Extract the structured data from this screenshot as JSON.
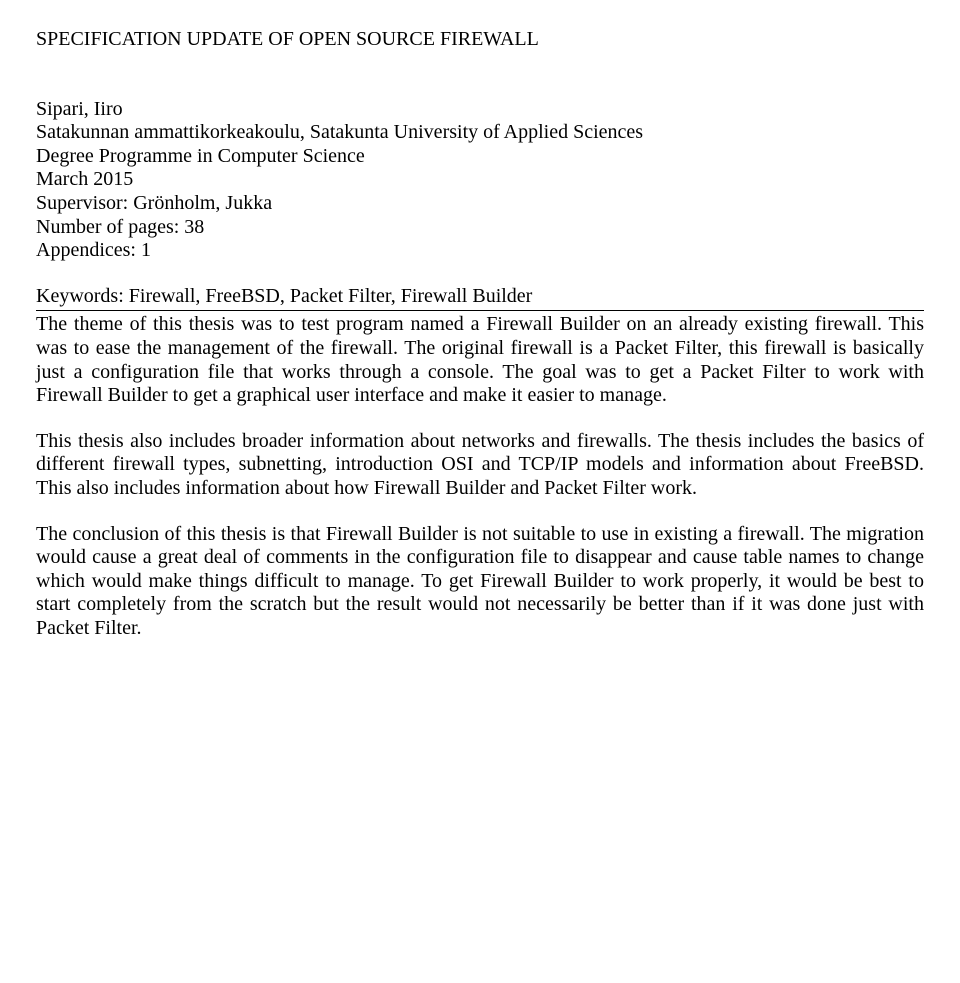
{
  "title": "SPECIFICATION UPDATE OF OPEN SOURCE FIREWALL",
  "meta": {
    "author": "Sipari, Iiro",
    "institution": "Satakunnan ammattikorkeakoulu, Satakunta University of Applied Sciences",
    "programme": "Degree Programme in Computer Science",
    "date": "March 2015",
    "supervisor": "Supervisor: Grönholm, Jukka",
    "pages": "Number of pages: 38",
    "appendices": "Appendices: 1"
  },
  "keywords": "Keywords: Firewall, FreeBSD, Packet Filter, Firewall Builder",
  "paragraphs": {
    "p1": "The theme of this thesis was to test program named a Firewall Builder on an already existing firewall. This was to ease the management of the firewall. The original firewall is a Packet Filter, this firewall is basically just a configuration file that works through a console. The goal was to get a Packet Filter to work with Firewall Builder to get a graphical user interface and make it easier to manage.",
    "p2": "This thesis also includes broader information about networks and firewalls. The thesis includes the basics of different firewall types, subnetting, introduction OSI and TCP/IP models and information about FreeBSD. This also includes information about how Firewall Builder and Packet Filter work.",
    "p3": "The conclusion of this thesis is that Firewall Builder is not suitable to use in existing a firewall. The migration would cause a great deal of comments in the configuration file to disappear and cause table names to change which would make things difficult to manage. To get Firewall Builder to work properly, it would be best to start completely from the scratch but the result would not necessarily be better than if it was done just with Packet Filter."
  }
}
